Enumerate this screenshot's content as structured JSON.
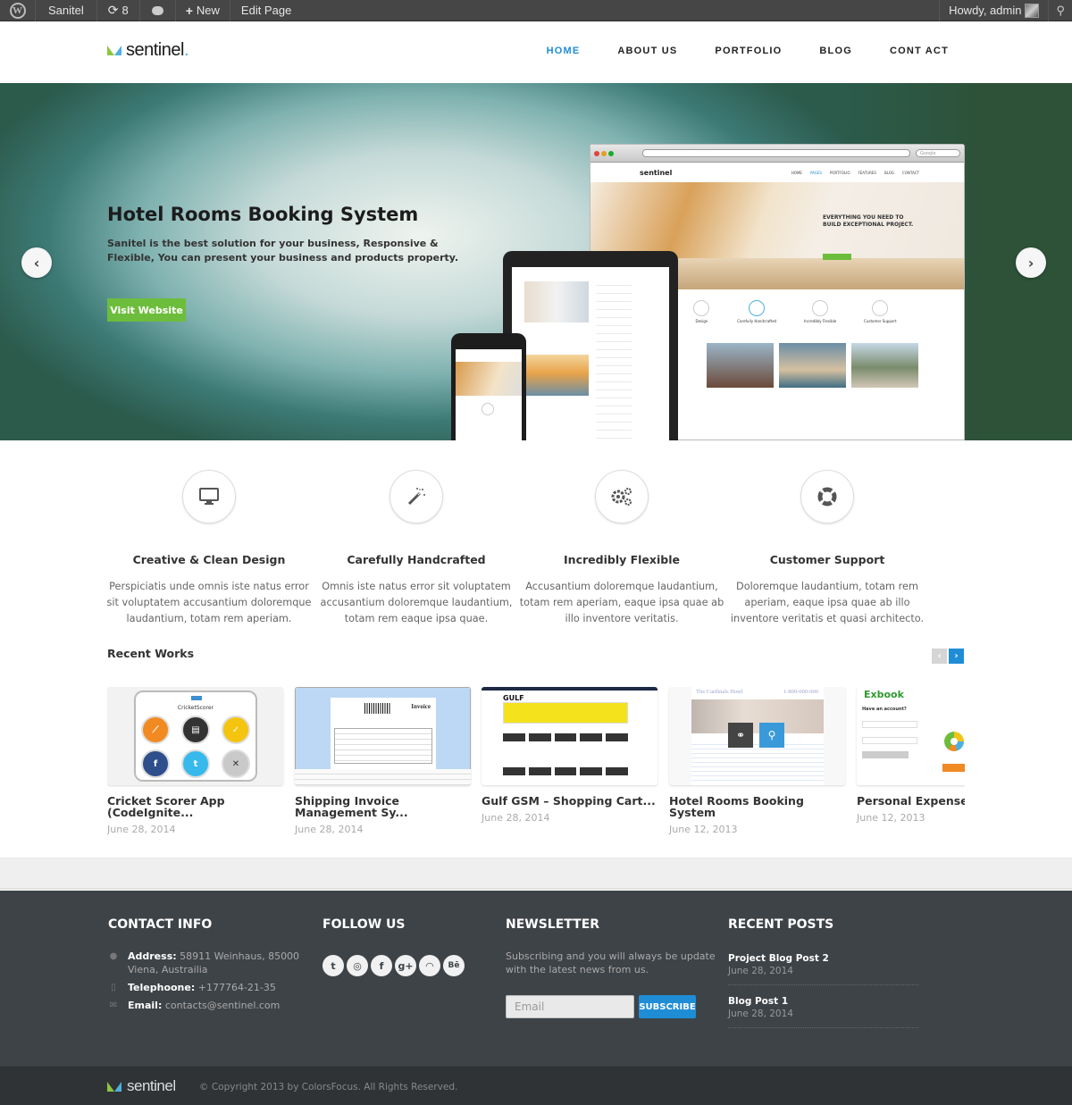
{
  "admin_bar": {
    "site_name": "Sanitel",
    "updates_count": "8",
    "new_label": "New",
    "edit_label": "Edit Page",
    "howdy": "Howdy, admin"
  },
  "header": {
    "logo_text": "sentinel",
    "logo_dot": ".",
    "nav": [
      {
        "label": "HOME",
        "active": true
      },
      {
        "label": "ABOUT US"
      },
      {
        "label": "PORTFOLIO"
      },
      {
        "label": "BLOG"
      },
      {
        "label": "CONT ACT"
      }
    ]
  },
  "hero": {
    "title": "Hotel Rooms Booking System",
    "subtitle": "Sanitel is the best solution for your business, Responsive & Flexible, You can present your business and products property.",
    "button": "Visit Website",
    "prev_icon": "‹",
    "next_icon": "›",
    "mock": {
      "logo": "sentinel",
      "menu": [
        "HOME",
        "PAGES",
        "PORTFOLIO",
        "FEATURES",
        "BLOG",
        "CONTACT"
      ],
      "search_placeholder": "Google",
      "headline": "EVERYTHING YOU NEED TO BUILD EXCEPTIONAL PROJECT.",
      "features": [
        "Design",
        "Carefully Handcrafted",
        "Incredibly Flexible",
        "Customer Support"
      ]
    }
  },
  "features": [
    {
      "icon": "monitor-icon",
      "title": "Creative & Clean Design",
      "desc": "Perspiciatis unde omnis iste natus error sit voluptatem accusantium doloremque laudantium, totam rem aperiam."
    },
    {
      "icon": "magic-wand-icon",
      "title": "Carefully Handcrafted",
      "desc": "Omnis iste natus error sit voluptatem accusantium doloremque laudantium, totam rem eaque ipsa quae."
    },
    {
      "icon": "gears-icon",
      "title": "Incredibly Flexible",
      "desc": "Accusantium doloremque laudantium, totam rem aperiam, eaque ipsa quae ab illo inventore veritatis."
    },
    {
      "icon": "lifebuoy-icon",
      "title": "Customer Support",
      "desc": "Doloremque laudantium, totam rem aperiam, eaque ipsa quae ab illo inventore veritatis et quasi architecto."
    }
  ],
  "recent_works": {
    "title": "Recent Works",
    "items": [
      {
        "title": "Cricket Scorer App (CodeIgnite...",
        "date": "June 28, 2014",
        "thumb_label": "CricketScorer"
      },
      {
        "title": "Shipping Invoice Management Sy...",
        "date": "June 28, 2014",
        "thumb_label": "Invoice"
      },
      {
        "title": "Gulf GSM – Shopping Cart...",
        "date": "June 28, 2014",
        "thumb_label": "GULF"
      },
      {
        "title": "Hotel Rooms Booking System",
        "date": "June 12, 2013",
        "thumb_label": "The Cardinals Hotel",
        "thumb_phone": "1-800-000-000"
      },
      {
        "title": "Personal Expense M Ap...",
        "date": "June 12, 2013",
        "thumb_label": "Exbook",
        "thumb_sub": "Have an account?"
      }
    ]
  },
  "footer": {
    "contact": {
      "heading": "CONTACT INFO",
      "address_label": "Address:",
      "address": "58911 Weinhaus, 85000 Viena, Austrailia",
      "phone_label": "Telephoone:",
      "phone": "+177764-21-35",
      "email_label": "Email:",
      "email": "contacts@sentinel.com"
    },
    "follow": {
      "heading": "FOLLOW US",
      "networks": [
        {
          "name": "twitter",
          "glyph": "t"
        },
        {
          "name": "dribbble",
          "glyph": "◎"
        },
        {
          "name": "facebook",
          "glyph": "f"
        },
        {
          "name": "google-plus",
          "glyph": "g+"
        },
        {
          "name": "rss",
          "glyph": "◠"
        },
        {
          "name": "behance",
          "glyph": "Bē"
        }
      ]
    },
    "newsletter": {
      "heading": "NEWSLETTER",
      "text": "Subscribing and you will always be update with the latest news from us.",
      "placeholder": "Email",
      "button": "SUBSCRIBE"
    },
    "recent_posts": {
      "heading": "RECENT POSTS",
      "posts": [
        {
          "title": "Project Blog Post 2",
          "date": "June 28, 2014"
        },
        {
          "title": "Blog Post 1",
          "date": "June 28, 2014"
        }
      ]
    }
  },
  "bottom": {
    "logo_text": "sentinel",
    "copyright": "© Copyright 2013 by ColorsFocus. All Rights Reserved."
  }
}
